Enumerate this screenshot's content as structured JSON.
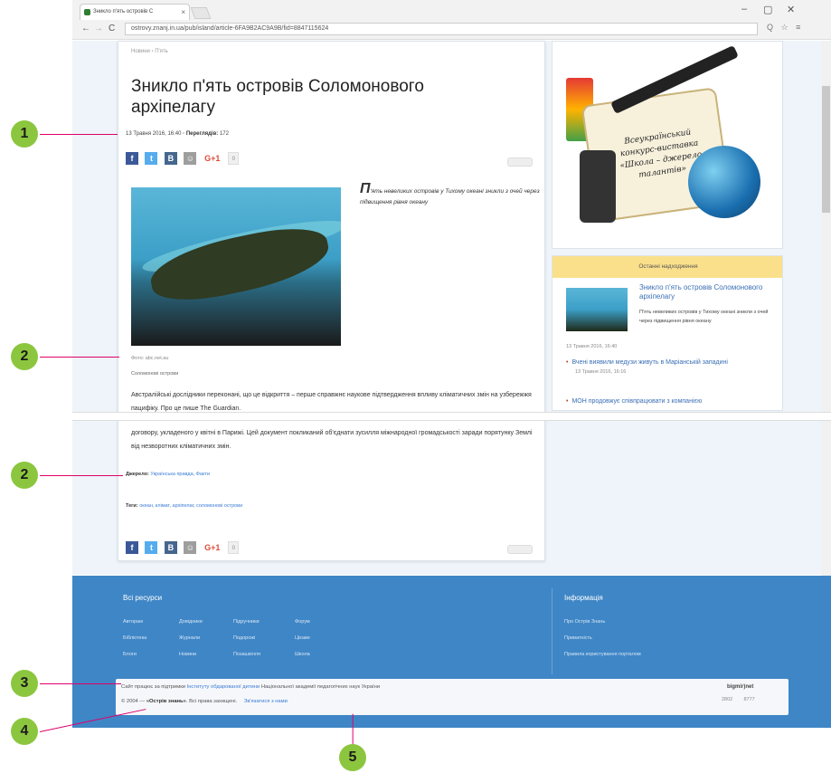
{
  "browser": {
    "tab_title": "Зникло п'ять островів С",
    "close_tab": "×",
    "url": "ostrovy.znanj.in.ua/pub/island/article-6FA9B2AC9A9B/fid=8847115624",
    "window_controls": [
      "–",
      "▢",
      "✕"
    ],
    "nav": {
      "back": "←",
      "forward": "→",
      "reload": "C"
    },
    "address_icons": "Q ☆ ≡"
  },
  "article": {
    "breadcrumb": "Новини › П'ять",
    "title": "Зникло п'ять островів Соломонового архіпелагу",
    "meta_date": "13 Травня 2016, 16:40",
    "meta_views_label": "Переглядів:",
    "meta_views": "172",
    "share": {
      "fb": "f",
      "tw": "t",
      "vk": "B",
      "ok": "☺",
      "gp": "G+1",
      "count": "0"
    },
    "lead_dropcap": "П",
    "lead": "'ять невеликих островів у Тихому океані зникли з очей через підвищення рівня океану",
    "photo_credit": "Фото: abc.net.au",
    "photo_caption": "Соломонові острови",
    "body1": "Австралійські дослідники переконані, що це відкриття – перше справжнє наукове підтвердження впливу кліматичних змін на узбережжя пацифіку. Про це пише The Guardian.",
    "body2": "договору, укладеного у квітні в Парижі. Цей документ покликаний об'єднати зусилля міжнародної громадськості заради порятунку Землі від незворотних кліматичних змін.",
    "sources_label": "Джерело:",
    "sources": "Українська правда, Факти",
    "tags_label": "Теги:",
    "tags": "океан, клімат, архіпелаг, соломонові острови",
    "share_bottom": {
      "fb": "f",
      "tw": "t",
      "vk": "B",
      "ok": "☺",
      "gp": "G+1",
      "count": "0"
    }
  },
  "sidebar": {
    "banner_text": "Всеукраїнський конкурс-виставка «Школа – джерело талантів»",
    "latest_header": "Останні надходження",
    "latest_title": "Зникло п'ять островів Соломонового архіпелагу",
    "latest_desc": "П'ять невеликих островів у Тихому океані зникли з очей через підвищення рівня океану",
    "latest_date": "13 Травня 2016, 16:40",
    "items": [
      {
        "title": "Вчені виявили медузи живуть в Маріанській западині",
        "date": "13 Травня 2016, 16:16"
      },
      {
        "title": "МОН продовжує співпрацювати з компанією",
        "date": ""
      }
    ]
  },
  "footer": {
    "resources_title": "Всі ресурси",
    "info_title": "Інформація",
    "resource_links": [
      [
        "Авторам",
        "Довідники",
        "Підручники",
        "Форум"
      ],
      [
        "Бібліотека",
        "Журнали",
        "Подорожі",
        "Цікаве"
      ],
      [
        "Блоги",
        "Новини",
        "Позашкілля",
        "Школа"
      ]
    ],
    "info_links": [
      "Про Острів Знань",
      "Приватність",
      "Правила користування порталом"
    ],
    "credits_prefix": "Сайт працює за підтримки",
    "credits_link": "Інституту обдарованої дитини",
    "credits_suffix": "Національної академії педагогічних наук України",
    "copyright_year": "© 2004 —",
    "copyright_name": "«Острів знань»",
    "copyright_rest": ". Всі права захищені.",
    "contact_link": "Зв'язатися з нами",
    "counter_name": "bigmir)net",
    "counter_stats": [
      "2802",
      "8777"
    ]
  },
  "callouts": [
    "1",
    "2",
    "2",
    "3",
    "4",
    "5"
  ],
  "colors": {
    "callout_marker": "#8cc63f",
    "callout_line": "#e0006a",
    "footer": "#3f86c6",
    "link": "#3a7bd5",
    "latest_header": "#fbe08c"
  }
}
